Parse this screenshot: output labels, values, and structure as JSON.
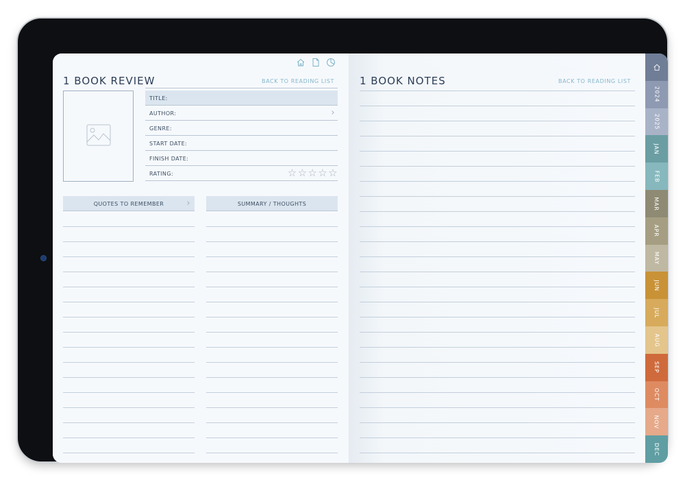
{
  "left": {
    "title": "1 BOOK REVIEW",
    "back_link": "BACK TO READING LIST",
    "top_icons": [
      "home-icon",
      "page-icon",
      "pie-chart-icon"
    ],
    "fields": [
      {
        "label": "TITLE:"
      },
      {
        "label": "AUTHOR:"
      },
      {
        "label": "GENRE:"
      },
      {
        "label": "START DATE:"
      },
      {
        "label": "FINISH DATE:"
      },
      {
        "label": "RATING:"
      }
    ],
    "rating_stars": 5,
    "quotes_header": "QUOTES TO REMEMBER",
    "summary_header": "SUMMARY / THOUGHTS"
  },
  "right": {
    "title": "1 BOOK NOTES",
    "back_link": "BACK TO READING LIST"
  },
  "tabs": [
    {
      "label": "",
      "icon": "home-icon",
      "color": "#6f7d97"
    },
    {
      "label": "2024",
      "color": "#8e9ab2"
    },
    {
      "label": "2025",
      "color": "#a9b3c8"
    },
    {
      "label": "JAN",
      "color": "#6a9ea3"
    },
    {
      "label": "FEB",
      "color": "#86b8bd"
    },
    {
      "label": "MAR",
      "color": "#8e8a73"
    },
    {
      "label": "APR",
      "color": "#a59e82"
    },
    {
      "label": "MAY",
      "color": "#bfb8a2"
    },
    {
      "label": "JUN",
      "color": "#c99237"
    },
    {
      "label": "JUL",
      "color": "#d7ab5b"
    },
    {
      "label": "AUG",
      "color": "#e4c58c"
    },
    {
      "label": "SEP",
      "color": "#cf6a3c"
    },
    {
      "label": "OCT",
      "color": "#de8b62"
    },
    {
      "label": "NOV",
      "color": "#e6a98a"
    },
    {
      "label": "DEC",
      "color": "#5f9ea3"
    }
  ]
}
